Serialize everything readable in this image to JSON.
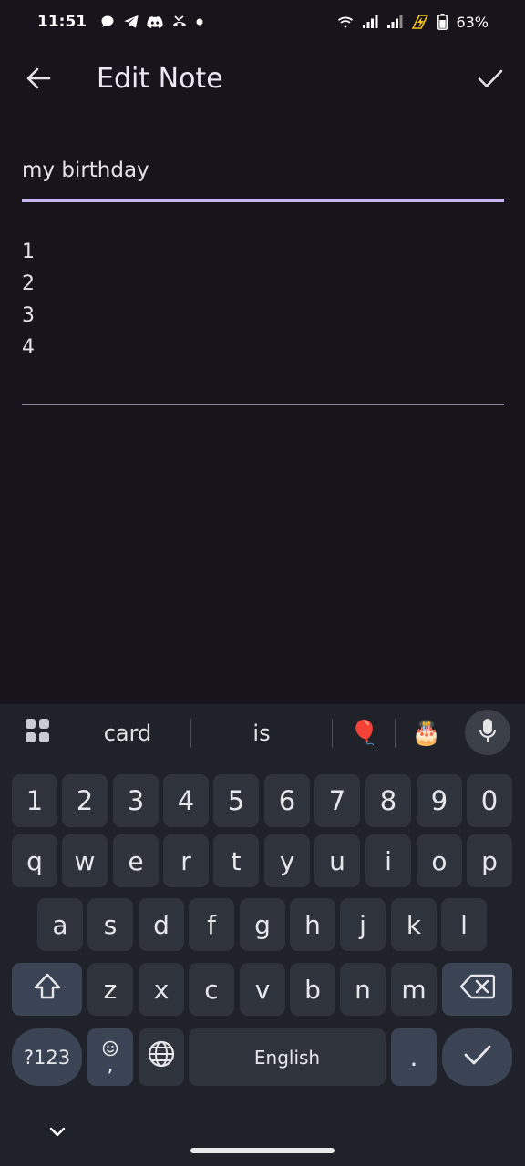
{
  "status_bar": {
    "time": "11:51",
    "battery_pct": "63%",
    "left_icons": [
      "chat-bubble-icon",
      "telegram-icon",
      "discord-icon",
      "missed-call-icon",
      "notification-dot-icon"
    ],
    "right_icons": [
      "wifi-icon",
      "signal-icon",
      "signal-icon-2",
      "charging-bolt-icon",
      "battery-icon"
    ]
  },
  "app_bar": {
    "title": "Edit Note"
  },
  "note": {
    "title": "my birthday",
    "body_lines": [
      "1",
      "2",
      "3",
      "4"
    ]
  },
  "keyboard": {
    "suggestions": [
      "card",
      "is"
    ],
    "emoji_suggestions": [
      "🎈",
      "🎂"
    ],
    "number_row": [
      "1",
      "2",
      "3",
      "4",
      "5",
      "6",
      "7",
      "8",
      "9",
      "0"
    ],
    "row1": [
      "q",
      "w",
      "e",
      "r",
      "t",
      "y",
      "u",
      "i",
      "o",
      "p"
    ],
    "row2": [
      "a",
      "s",
      "d",
      "f",
      "g",
      "h",
      "j",
      "k",
      "l"
    ],
    "row3": [
      "z",
      "x",
      "c",
      "v",
      "b",
      "n",
      "m"
    ],
    "symbols_label": "?123",
    "comma_label": ",",
    "space_label": "English",
    "period_label": "."
  },
  "colors": {
    "background": "#17141c",
    "accent_underline": "#c8b4f0",
    "keyboard_bg": "#1f2329",
    "key_bg": "#2f343c",
    "key_mod_bg": "#3b4454"
  }
}
